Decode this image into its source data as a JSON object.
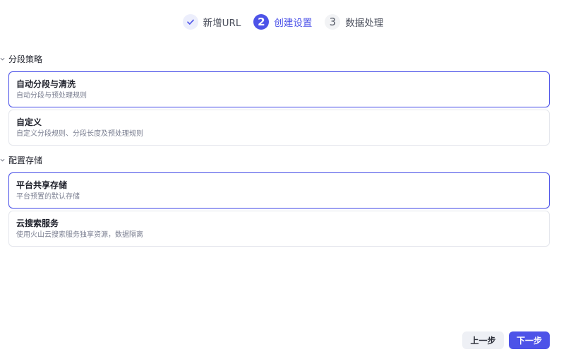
{
  "stepper": {
    "steps": [
      {
        "number": "",
        "label": "新增URL",
        "state": "done"
      },
      {
        "number": "2",
        "label": "创建设置",
        "state": "active"
      },
      {
        "number": "3",
        "label": "数据处理",
        "state": "todo"
      }
    ]
  },
  "segmentation": {
    "title": "分段策略",
    "options": [
      {
        "title": "自动分段与清洗",
        "desc": "自动分段与预处理规则",
        "selected": true
      },
      {
        "title": "自定义",
        "desc": "自定义分段规则、分段长度及预处理规则",
        "selected": false
      }
    ]
  },
  "storage": {
    "title": "配置存储",
    "options": [
      {
        "title": "平台共享存储",
        "desc": "平台预置的默认存储",
        "selected": true
      },
      {
        "title": "云搜索服务",
        "desc": "使用火山云搜索服务独享资源，数据隔离",
        "selected": false
      }
    ]
  },
  "footer": {
    "prev_label": "上一步",
    "next_label": "下一步"
  },
  "colors": {
    "accent": "#4d53e8",
    "border": "#e4e6ec"
  },
  "icons": {
    "step_done": "check-icon",
    "section_toggle": "chevron-down-icon"
  }
}
